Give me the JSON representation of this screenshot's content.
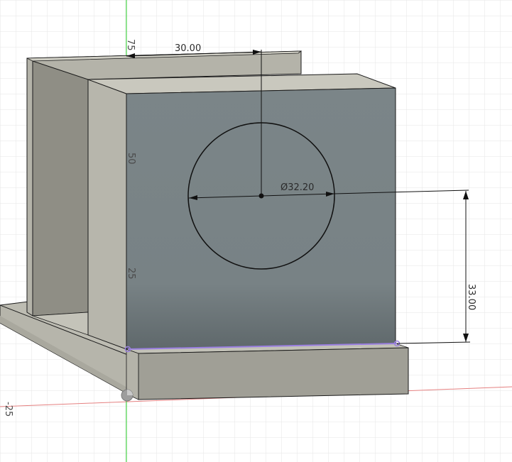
{
  "viewport": {
    "background_color": "#ffffff",
    "grid_color": "#e3e3e3",
    "grid_major_color": "#d6d6d6",
    "x_axis_color": "#e26060",
    "y_axis_color": "#3dcc3d"
  },
  "model": {
    "body_color": "#b9b8ae",
    "body_dark_color": "#8f8e85",
    "sketch_face_color": "#7d878a",
    "edge_color": "#1a1a1a",
    "selection_color": "#9a7fe0"
  },
  "dimensions": {
    "horizontal_offset": "30.00",
    "circle_diameter": "Ø32.20",
    "vertical_offset": "33.00"
  },
  "ruler_labels": {
    "top": "75",
    "middle": "50",
    "lower": "25",
    "axis_negative": "-25"
  },
  "icons": {
    "origin": "origin-icon",
    "center_point": "center-point-icon",
    "endpoint": "endpoint-icon"
  }
}
